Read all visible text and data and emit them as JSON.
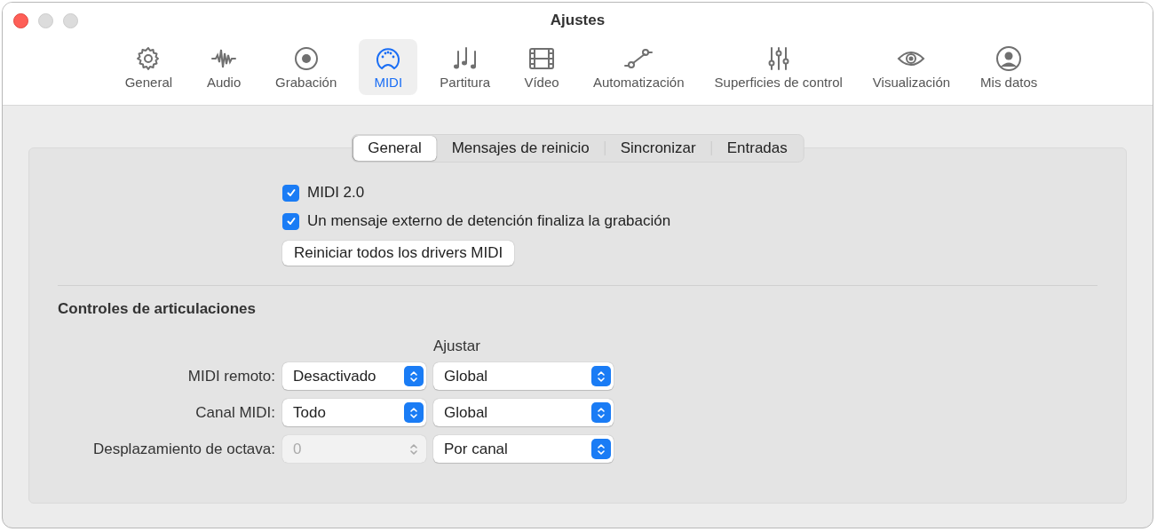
{
  "window": {
    "title": "Ajustes"
  },
  "toolbar": [
    {
      "label": "General",
      "selected": false
    },
    {
      "label": "Audio",
      "selected": false
    },
    {
      "label": "Grabación",
      "selected": false
    },
    {
      "label": "MIDI",
      "selected": true
    },
    {
      "label": "Partitura",
      "selected": false
    },
    {
      "label": "Vídeo",
      "selected": false
    },
    {
      "label": "Automatización",
      "selected": false
    },
    {
      "label": "Superficies de control",
      "selected": false
    },
    {
      "label": "Visualización",
      "selected": false
    },
    {
      "label": "Mis datos",
      "selected": false
    }
  ],
  "tabs": [
    {
      "label": "General",
      "selected": true
    },
    {
      "label": "Mensajes de reinicio",
      "selected": false
    },
    {
      "label": "Sincronizar",
      "selected": false
    },
    {
      "label": "Entradas",
      "selected": false
    }
  ],
  "checkboxes": [
    {
      "label": "MIDI 2.0",
      "checked": true
    },
    {
      "label": "Un mensaje externo de detención finaliza la grabación",
      "checked": true
    }
  ],
  "reset_button": "Reiniciar todos los drivers MIDI",
  "articulation": {
    "heading": "Controles de articulaciones",
    "column_header": "Ajustar",
    "rows": [
      {
        "label": "MIDI remoto:",
        "value": "Desactivado",
        "disabled": false,
        "adjust": "Global"
      },
      {
        "label": "Canal MIDI:",
        "value": "Todo",
        "disabled": false,
        "adjust": "Global"
      },
      {
        "label": "Desplazamiento de octava:",
        "value": "0",
        "disabled": true,
        "adjust": "Por canal"
      }
    ]
  }
}
